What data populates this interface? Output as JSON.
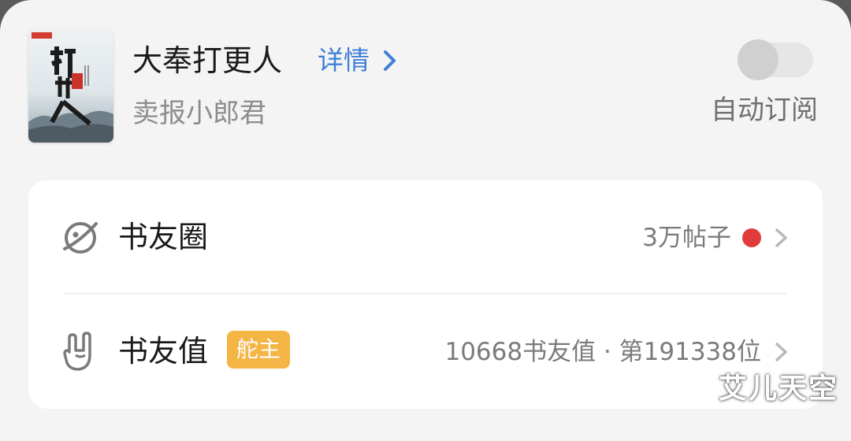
{
  "book": {
    "title": "大奉打更人",
    "details_label": "详情",
    "author": "卖报小郎君",
    "cover_icon": "book-cover-image"
  },
  "subscription": {
    "label": "自动订阅",
    "enabled": false
  },
  "rows": [
    {
      "label": "书友圈",
      "meta": "3万帖子",
      "icon": "planet-icon",
      "has_red_dot": true
    },
    {
      "label": "书友值",
      "badge": "舵主",
      "meta": "10668书友值 · 第191338位",
      "icon": "rock-hand-icon"
    }
  ],
  "watermark": "艾儿天空",
  "colors": {
    "link_blue": "#3f7fd6",
    "badge_orange": "#f5b545",
    "red_dot": "#e23b3b"
  }
}
